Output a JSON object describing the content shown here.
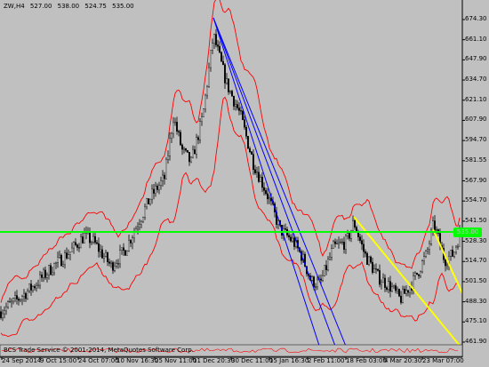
{
  "header": {
    "symbol": "ZW,H4",
    "open": "527.00",
    "high": "538.00",
    "low": "524.75",
    "close": "535.00"
  },
  "price_axis": {
    "labels": [
      "674.30",
      "661.10",
      "647.90",
      "634.70",
      "621.10",
      "607.90",
      "594.70",
      "581.55",
      "567.90",
      "554.70",
      "541.50",
      "528.30",
      "514.70",
      "501.50",
      "488.30",
      "475.10",
      "461.90"
    ]
  },
  "current_price_label": "535.00",
  "time_axis": {
    "labels": [
      "24 Sep 2014",
      "9 Oct 15:00",
      "24 Oct 07:00",
      "10 Nov 16:30",
      "25 Nov 11:00",
      "11 Dec 20:30",
      "30 Dec 11:00",
      "15 Jan 16:30",
      "2 Feb 11:00",
      "18 Feb 03:00",
      "4 Mar 20:30",
      "23 Mar 07:00"
    ]
  },
  "footer": {
    "copyright": "BCS Trade Service © 2001-2014, MetaQuotes Software Corp."
  },
  "colors": {
    "background": "#c0c0c0",
    "candles": "#000000",
    "bands": "#ff0000",
    "trendlines": "#0000ff",
    "yellow_trendlines": "#ffff00",
    "horizontal_level": "#00ff00"
  }
}
